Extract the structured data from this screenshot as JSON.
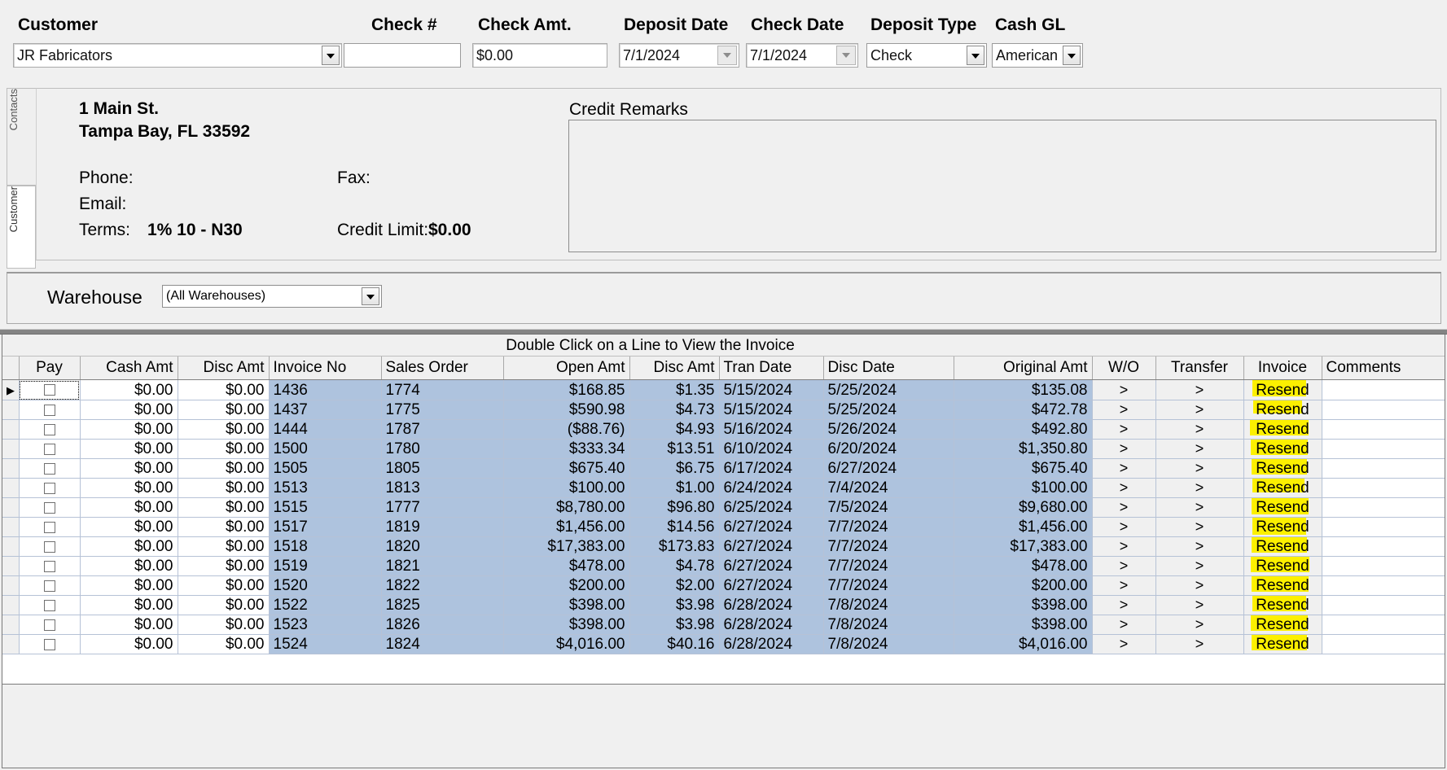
{
  "header": {
    "fields": [
      {
        "label": "Customer",
        "value": "JR Fabricators",
        "type": "combo"
      },
      {
        "label": "Check #",
        "value": "",
        "type": "text"
      },
      {
        "label": "Check Amt.",
        "value": "$0.00",
        "type": "text"
      },
      {
        "label": "Deposit Date",
        "value": "7/1/2024",
        "type": "date"
      },
      {
        "label": "Check Date",
        "value": "7/1/2024",
        "type": "date"
      },
      {
        "label": "Deposit Type",
        "value": "Check",
        "type": "combo"
      },
      {
        "label": "Cash GL",
        "value": "American E",
        "type": "combo"
      }
    ]
  },
  "tabs": {
    "contacts_label": "Contacts",
    "customer_label": "Customer"
  },
  "customer": {
    "address_line1": "1 Main St.",
    "address_line2": "Tampa Bay, FL  33592",
    "phone_label": "Phone:",
    "phone_value": "",
    "fax_label": "Fax:",
    "fax_value": "",
    "email_label": "Email:",
    "email_value": "",
    "terms_label": "Terms:",
    "terms_value": "1% 10 - N30",
    "credit_limit_label": "Credit Limit:",
    "credit_limit_value": "$0.00"
  },
  "credit_remarks": {
    "title": "Credit Remarks",
    "value": ""
  },
  "warehouse": {
    "label": "Warehouse",
    "value": "(All Warehouses)"
  },
  "grid": {
    "caption": "Double Click on a Line to View the Invoice",
    "columns": [
      "Pay",
      "Cash Amt",
      "Disc Amt",
      "Invoice No",
      "Sales Order",
      "Open Amt",
      "Disc Amt",
      "Tran Date",
      "Disc Date",
      "Original Amt",
      "W/O",
      "Transfer",
      "Invoice",
      "Comments"
    ],
    "wo_label": ">",
    "transfer_label": ">",
    "invoice_label": "Resend",
    "rows": [
      {
        "selected": true,
        "pay": false,
        "cash_amt": "$0.00",
        "disc_amt_l": "$0.00",
        "invoice_no": "1436",
        "sales_order": "1774",
        "open_amt": "$168.85",
        "disc_amt_r": "$1.35",
        "tran_date": "5/15/2024",
        "disc_date": "5/25/2024",
        "original_amt": "$135.08",
        "comments": ""
      },
      {
        "selected": false,
        "pay": false,
        "cash_amt": "$0.00",
        "disc_amt_l": "$0.00",
        "invoice_no": "1437",
        "sales_order": "1775",
        "open_amt": "$590.98",
        "disc_amt_r": "$4.73",
        "tran_date": "5/15/2024",
        "disc_date": "5/25/2024",
        "original_amt": "$472.78",
        "comments": ""
      },
      {
        "selected": false,
        "pay": false,
        "cash_amt": "$0.00",
        "disc_amt_l": "$0.00",
        "invoice_no": "1444",
        "sales_order": "1787",
        "open_amt": "($88.76)",
        "disc_amt_r": "$4.93",
        "tran_date": "5/16/2024",
        "disc_date": "5/26/2024",
        "original_amt": "$492.80",
        "comments": ""
      },
      {
        "selected": false,
        "pay": false,
        "cash_amt": "$0.00",
        "disc_amt_l": "$0.00",
        "invoice_no": "1500",
        "sales_order": "1780",
        "open_amt": "$333.34",
        "disc_amt_r": "$13.51",
        "tran_date": "6/10/2024",
        "disc_date": "6/20/2024",
        "original_amt": "$1,350.80",
        "comments": ""
      },
      {
        "selected": false,
        "pay": false,
        "cash_amt": "$0.00",
        "disc_amt_l": "$0.00",
        "invoice_no": "1505",
        "sales_order": "1805",
        "open_amt": "$675.40",
        "disc_amt_r": "$6.75",
        "tran_date": "6/17/2024",
        "disc_date": "6/27/2024",
        "original_amt": "$675.40",
        "comments": ""
      },
      {
        "selected": false,
        "pay": false,
        "cash_amt": "$0.00",
        "disc_amt_l": "$0.00",
        "invoice_no": "1513",
        "sales_order": "1813",
        "open_amt": "$100.00",
        "disc_amt_r": "$1.00",
        "tran_date": "6/24/2024",
        "disc_date": "7/4/2024",
        "original_amt": "$100.00",
        "comments": ""
      },
      {
        "selected": false,
        "pay": false,
        "cash_amt": "$0.00",
        "disc_amt_l": "$0.00",
        "invoice_no": "1515",
        "sales_order": "1777",
        "open_amt": "$8,780.00",
        "disc_amt_r": "$96.80",
        "tran_date": "6/25/2024",
        "disc_date": "7/5/2024",
        "original_amt": "$9,680.00",
        "comments": ""
      },
      {
        "selected": false,
        "pay": false,
        "cash_amt": "$0.00",
        "disc_amt_l": "$0.00",
        "invoice_no": "1517",
        "sales_order": "1819",
        "open_amt": "$1,456.00",
        "disc_amt_r": "$14.56",
        "tran_date": "6/27/2024",
        "disc_date": "7/7/2024",
        "original_amt": "$1,456.00",
        "comments": ""
      },
      {
        "selected": false,
        "pay": false,
        "cash_amt": "$0.00",
        "disc_amt_l": "$0.00",
        "invoice_no": "1518",
        "sales_order": "1820",
        "open_amt": "$17,383.00",
        "disc_amt_r": "$173.83",
        "tran_date": "6/27/2024",
        "disc_date": "7/7/2024",
        "original_amt": "$17,383.00",
        "comments": ""
      },
      {
        "selected": false,
        "pay": false,
        "cash_amt": "$0.00",
        "disc_amt_l": "$0.00",
        "invoice_no": "1519",
        "sales_order": "1821",
        "open_amt": "$478.00",
        "disc_amt_r": "$4.78",
        "tran_date": "6/27/2024",
        "disc_date": "7/7/2024",
        "original_amt": "$478.00",
        "comments": ""
      },
      {
        "selected": false,
        "pay": false,
        "cash_amt": "$0.00",
        "disc_amt_l": "$0.00",
        "invoice_no": "1520",
        "sales_order": "1822",
        "open_amt": "$200.00",
        "disc_amt_r": "$2.00",
        "tran_date": "6/27/2024",
        "disc_date": "7/7/2024",
        "original_amt": "$200.00",
        "comments": ""
      },
      {
        "selected": false,
        "pay": false,
        "cash_amt": "$0.00",
        "disc_amt_l": "$0.00",
        "invoice_no": "1522",
        "sales_order": "1825",
        "open_amt": "$398.00",
        "disc_amt_r": "$3.98",
        "tran_date": "6/28/2024",
        "disc_date": "7/8/2024",
        "original_amt": "$398.00",
        "comments": ""
      },
      {
        "selected": false,
        "pay": false,
        "cash_amt": "$0.00",
        "disc_amt_l": "$0.00",
        "invoice_no": "1523",
        "sales_order": "1826",
        "open_amt": "$398.00",
        "disc_amt_r": "$3.98",
        "tran_date": "6/28/2024",
        "disc_date": "7/8/2024",
        "original_amt": "$398.00",
        "comments": ""
      },
      {
        "selected": false,
        "pay": false,
        "cash_amt": "$0.00",
        "disc_amt_l": "$0.00",
        "invoice_no": "1524",
        "sales_order": "1824",
        "open_amt": "$4,016.00",
        "disc_amt_r": "$40.16",
        "tran_date": "6/28/2024",
        "disc_date": "7/8/2024",
        "original_amt": "$4,016.00",
        "comments": ""
      }
    ]
  },
  "colors": {
    "row_selected": "#aec3de",
    "highlight": "#fcf000",
    "window_bg": "#f0f0f0"
  }
}
